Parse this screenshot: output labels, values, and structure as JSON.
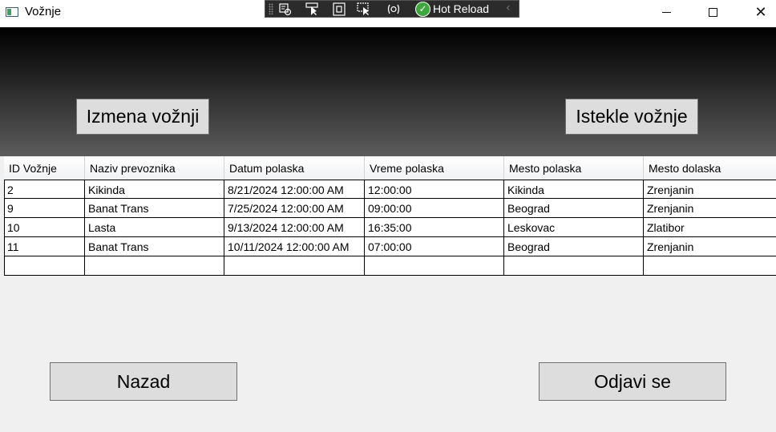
{
  "window": {
    "title": "Vožnje",
    "minimize_glyph": "",
    "maximize_glyph": "",
    "close_glyph": "✕"
  },
  "debug_toolbar": {
    "icons": [
      "select-element-icon",
      "pointer-select-icon",
      "layout-adorner-icon",
      "track-focus-icon",
      "binding-failures-icon"
    ],
    "hot_reload_label": "Hot Reload",
    "hot_reload_status_icon": "check-circle-icon",
    "collapse_icon": "chevron-left-icon"
  },
  "header": {
    "izmena_label": "Izmena vožnji",
    "istekle_label": "Istekle vožnje"
  },
  "table": {
    "columns": [
      "ID Vožnje",
      "Naziv prevoznika",
      "Datum polaska",
      "Vreme polaska",
      "Mesto polaska",
      "Mesto dolaska"
    ],
    "rows": [
      [
        "2",
        "Kikinda",
        "8/21/2024 12:00:00 AM",
        "12:00:00",
        "Kikinda",
        "Zrenjanin"
      ],
      [
        "9",
        "Banat Trans",
        "7/25/2024 12:00:00 AM",
        "09:00:00",
        "Beograd",
        "Zrenjanin"
      ],
      [
        "10",
        "Lasta",
        "9/13/2024 12:00:00 AM",
        "16:35:00",
        "Leskovac",
        "Zlatibor"
      ],
      [
        "11",
        "Banat Trans",
        "10/11/2024 12:00:00 AM",
        "07:00:00",
        "Beograd",
        "Zrenjanin"
      ],
      [
        "",
        "",
        "",
        "",
        "",
        ""
      ]
    ]
  },
  "footer": {
    "nazad_label": "Nazad",
    "odjavi_label": "Odjavi se"
  },
  "colors": {
    "header_gradient_top": "#000000",
    "header_gradient_bottom": "#5c5c5c",
    "button_bg": "#dddddd",
    "hot_reload_green": "#3ea83e"
  }
}
